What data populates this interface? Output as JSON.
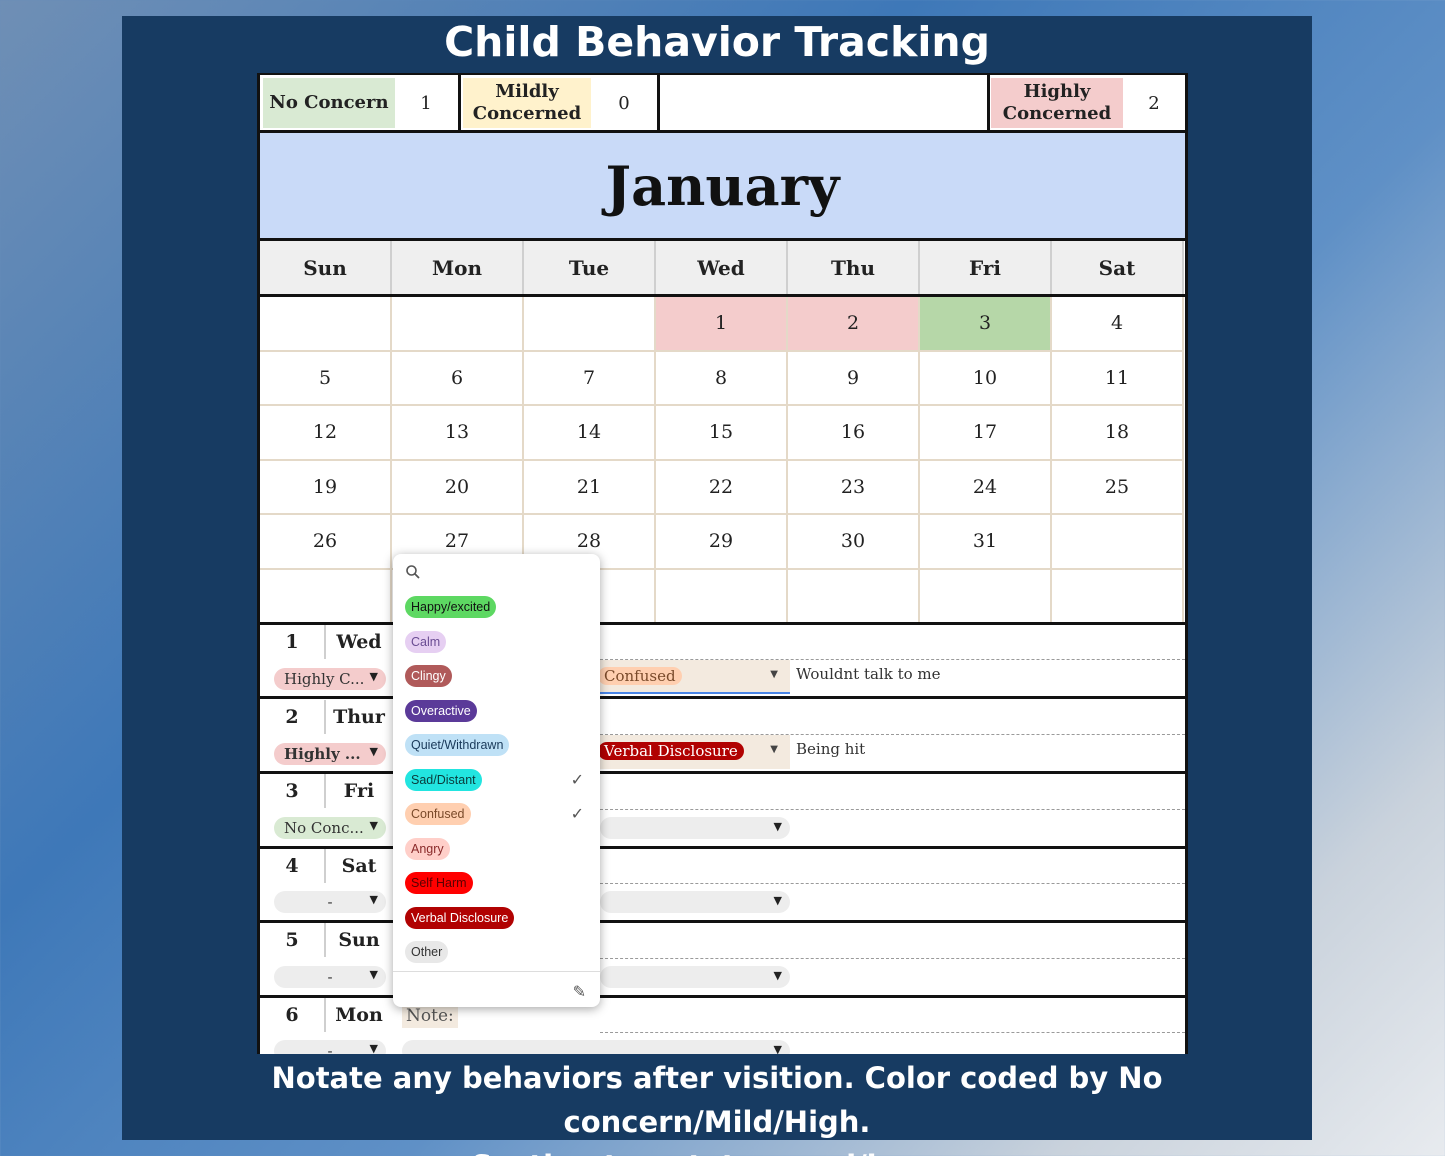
{
  "title": "Child Behavior Tracking",
  "caption": {
    "line1": "Notate any behaviors after visition. Color coded by No concern/Mild/High.",
    "line2": "Section to notate mood/issue."
  },
  "legend": {
    "no_concern": {
      "label": "No Concern",
      "count": "1",
      "color": "#d9ead3"
    },
    "mild": {
      "label1": "Mildly",
      "label2": "Concerned",
      "count": "0",
      "color": "#fff2cc"
    },
    "high": {
      "label1": "Highly",
      "label2": "Concerned",
      "count": "2",
      "color": "#f4cccc"
    }
  },
  "month": "January",
  "weekdays": [
    "Sun",
    "Mon",
    "Tue",
    "Wed",
    "Thu",
    "Fri",
    "Sat"
  ],
  "weeks": [
    [
      "",
      "",
      "",
      "1",
      "2",
      "3",
      "4"
    ],
    [
      "5",
      "6",
      "7",
      "8",
      "9",
      "10",
      "11"
    ],
    [
      "12",
      "13",
      "14",
      "15",
      "16",
      "17",
      "18"
    ],
    [
      "19",
      "20",
      "21",
      "22",
      "23",
      "24",
      "25"
    ],
    [
      "26",
      "27",
      "28",
      "29",
      "30",
      "31",
      ""
    ],
    [
      "",
      "",
      "",
      "",
      "",
      "",
      ""
    ]
  ],
  "details": [
    {
      "num": "1",
      "day": "Wed",
      "concern": "Highly C...",
      "mood": "Confused",
      "note": "Wouldnt talk to me"
    },
    {
      "num": "2",
      "day": "Thur",
      "concern": "Highly ...",
      "mood": "Verbal Disclosure",
      "note": "Being hit"
    },
    {
      "num": "3",
      "day": "Fri",
      "concern": "No Conc...",
      "mood": "",
      "note": ""
    },
    {
      "num": "4",
      "day": "Sat",
      "concern": "-",
      "mood": "",
      "note": ""
    },
    {
      "num": "5",
      "day": "Sun",
      "concern": "-",
      "mood": "",
      "note": ""
    },
    {
      "num": "6",
      "day": "Mon",
      "concern": "-",
      "mood": "",
      "note": ""
    }
  ],
  "note_label": "Note:",
  "mood_options": [
    {
      "label": "Happy/excited",
      "bg": "#5dd862",
      "fg": "#111",
      "checked": false
    },
    {
      "label": "Calm",
      "bg": "#e6cff2",
      "fg": "#6a4c93",
      "checked": false
    },
    {
      "label": "Clingy",
      "bg": "#b05a5a",
      "fg": "#fff",
      "checked": false
    },
    {
      "label": "Overactive",
      "bg": "#5b3a99",
      "fg": "#fff",
      "checked": false
    },
    {
      "label": "Quiet/Withdrawn",
      "bg": "#bfe1f6",
      "fg": "#1a3a5a",
      "checked": false
    },
    {
      "label": "Sad/Distant",
      "bg": "#22e5e0",
      "fg": "#0a3a3a",
      "checked": true
    },
    {
      "label": "Confused",
      "bg": "#ffcfb0",
      "fg": "#7a4a2a",
      "checked": true
    },
    {
      "label": "Angry",
      "bg": "#ffcfc9",
      "fg": "#8a2a2a",
      "checked": false
    },
    {
      "label": "Self Harm",
      "bg": "#ff0000",
      "fg": "#5a0000",
      "checked": false
    },
    {
      "label": "Verbal Disclosure",
      "bg": "#b10202",
      "fg": "#fff",
      "checked": false
    },
    {
      "label": "Other",
      "bg": "#e8e8e8",
      "fg": "#333",
      "checked": false
    }
  ],
  "icons": {
    "search": "search-icon",
    "edit": "pencil-icon",
    "check": "checkmark-icon",
    "dropdown": "dropdown-arrow-icon"
  }
}
